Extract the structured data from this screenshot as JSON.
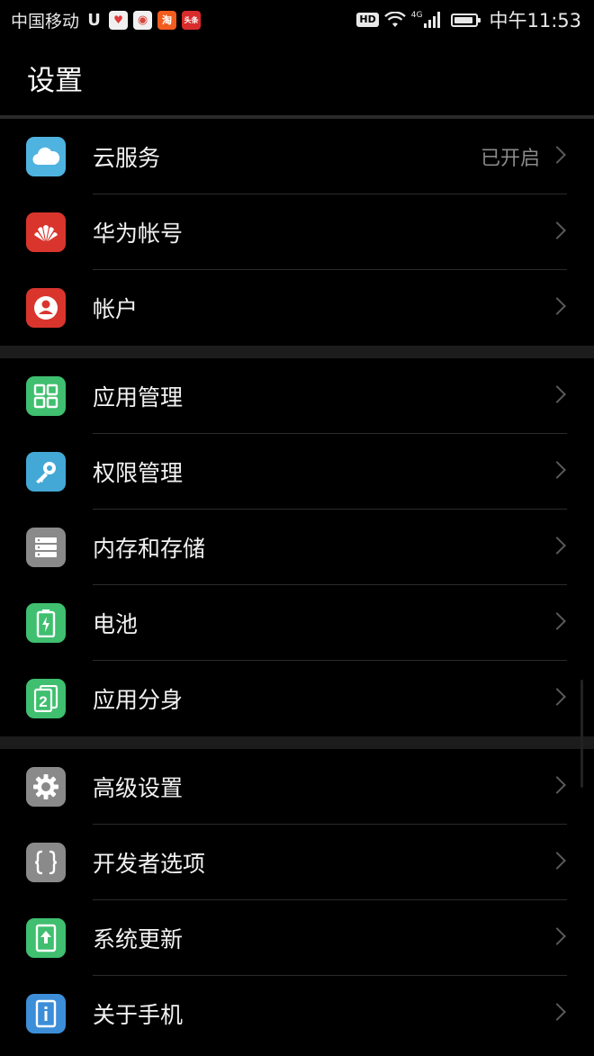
{
  "status_bar": {
    "carrier": "中国移动",
    "apps": [
      {
        "icon": "shield-u-icon",
        "glyph": "U",
        "color": "#000000"
      },
      {
        "icon": "map-pin-app-icon",
        "glyph": "♥",
        "color": "#e03a3a"
      },
      {
        "icon": "weibo-app-icon",
        "glyph": "◉",
        "color": "#d8453a"
      },
      {
        "icon": "taobao-app-icon",
        "glyph": "淘",
        "color": "#f25c1e"
      },
      {
        "icon": "toutiao-app-icon",
        "glyph": "头条",
        "color": "#d82b2b"
      }
    ],
    "hd": "HD",
    "network": "4G",
    "time": "中午11:53"
  },
  "header": {
    "title": "设置"
  },
  "groups": [
    {
      "items": [
        {
          "label": "云服务",
          "value": "已开启",
          "icon": "cloud-icon",
          "color": "#4fb3e0"
        },
        {
          "label": "华为帐号",
          "value": "",
          "icon": "huawei-logo-icon",
          "color": "#d9352d"
        },
        {
          "label": "帐户",
          "value": "",
          "icon": "user-account-icon",
          "color": "#d9352d"
        }
      ]
    },
    {
      "items": [
        {
          "label": "应用管理",
          "value": "",
          "icon": "app-grid-icon",
          "color": "#3fbf6f"
        },
        {
          "label": "权限管理",
          "value": "",
          "icon": "key-icon",
          "color": "#43a8d6"
        },
        {
          "label": "内存和存储",
          "value": "",
          "icon": "storage-icon",
          "color": "#8a8a8a"
        },
        {
          "label": "电池",
          "value": "",
          "icon": "battery-icon",
          "color": "#3fbf6f"
        },
        {
          "label": "应用分身",
          "value": "",
          "icon": "app-twin-icon",
          "color": "#3fbf6f"
        }
      ]
    },
    {
      "items": [
        {
          "label": "高级设置",
          "value": "",
          "icon": "gear-icon",
          "color": "#8a8a8a"
        },
        {
          "label": "开发者选项",
          "value": "",
          "icon": "braces-icon",
          "color": "#8a8a8a"
        },
        {
          "label": "系统更新",
          "value": "",
          "icon": "system-update-icon",
          "color": "#3fbf6f"
        },
        {
          "label": "关于手机",
          "value": "",
          "icon": "info-icon",
          "color": "#3d8ed8"
        }
      ]
    }
  ]
}
